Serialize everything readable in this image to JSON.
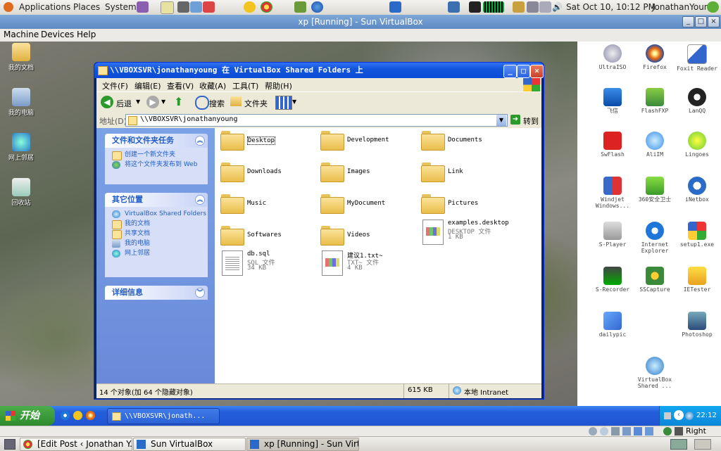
{
  "gnome_top": {
    "menus": [
      "Applications",
      "Places",
      "System"
    ],
    "datetime": "Sat Oct 10, 10:12 PM",
    "user": "JonathanYoung"
  },
  "vbox": {
    "title": "xp [Running] - Sun VirtualBox",
    "menu": [
      "Machine",
      "Devices",
      "Help"
    ],
    "status_right": "Right Ctrl"
  },
  "desktop_left": [
    "我的文档",
    "我的电脑",
    "网上邻居",
    "回收站"
  ],
  "desktop_right": [
    [
      "UltraISO",
      "Firefox",
      "Foxit Reader"
    ],
    [
      "飞信",
      "FlashFXP",
      "LanQQ"
    ],
    [
      "SwFlash",
      "AliIM",
      "Lingoes"
    ],
    [
      "Windjet Windows...",
      "360安全卫士",
      "iNetbox"
    ],
    [
      "S-Player",
      "Internet Explorer",
      "setup1.exe"
    ],
    [
      "S-Recorder",
      "SSCapture",
      "IETester"
    ],
    [
      "dailypic",
      "",
      "Photoshop"
    ],
    [
      "",
      "VirtualBox Shared ...",
      ""
    ]
  ],
  "explorer": {
    "title": "\\\\VBOXSVR\\jonathanyoung 在 VirtualBox Shared Folders 上",
    "menu": [
      "文件(F)",
      "编辑(E)",
      "查看(V)",
      "收藏(A)",
      "工具(T)",
      "帮助(H)"
    ],
    "toolbar": {
      "back": "后退",
      "search": "搜索",
      "folders": "文件夹"
    },
    "address_label": "地址(D)",
    "address": "\\\\VBOXSVR\\jonathanyoung",
    "go": "转到",
    "tasks_panel": {
      "title": "文件和文件夹任务",
      "items": [
        "创建一个新文件夹",
        "将这个文件夹发布到 Web"
      ]
    },
    "places_panel": {
      "title": "其它位置",
      "items": [
        "VirtualBox Shared Folders",
        "我的文档",
        "共享文档",
        "我的电脑",
        "网上邻居"
      ]
    },
    "details_panel": {
      "title": "详细信息"
    },
    "folders": [
      "Desktop",
      "Development",
      "Documents",
      "Downloads",
      "Images",
      "Link",
      "Music",
      "MyDocument",
      "Pictures",
      "Softwares",
      "Videos"
    ],
    "files": [
      {
        "name": "examples.desktop",
        "type": "DESKTOP 文件",
        "size": "1 KB"
      },
      {
        "name": "db.sql",
        "type": "SQL 文件",
        "size": "34 KB"
      },
      {
        "name": "建议1.txt~",
        "type": "TXT~ 文件",
        "size": "4 KB"
      }
    ],
    "status": {
      "count": "14 个对象(加 64 个隐藏对象)",
      "size": "615 KB",
      "zone": "本地 Intranet"
    }
  },
  "xp_taskbar": {
    "start": "开始",
    "task": "\\\\VBOXSVR\\jonath...",
    "time": "22:12"
  },
  "gnome_bottom": {
    "tasks": [
      "[Edit Post ‹ Jonathan Y...",
      "Sun VirtualBox",
      "xp [Running] - Sun Virt..."
    ]
  }
}
